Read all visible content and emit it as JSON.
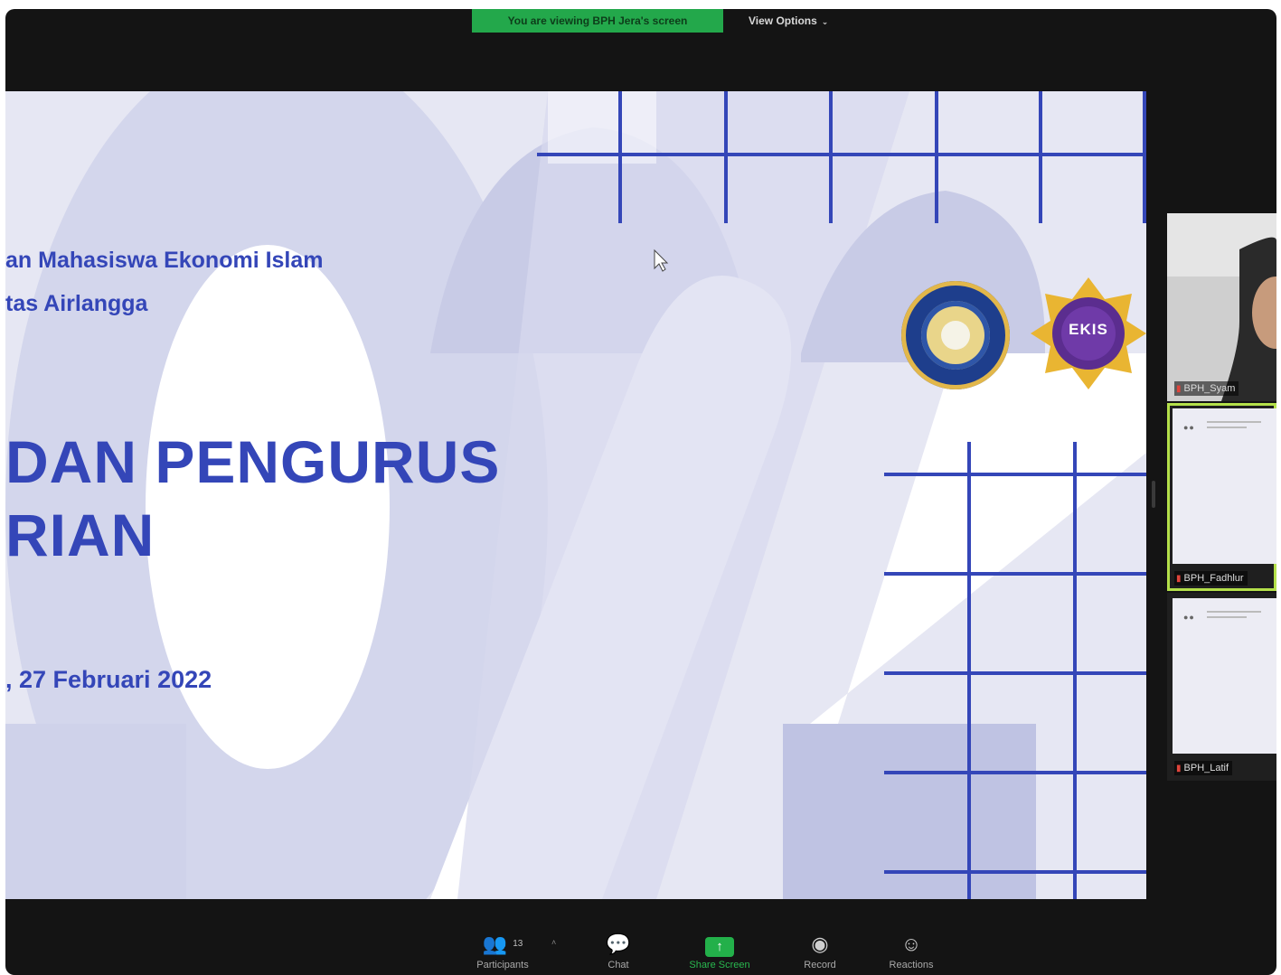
{
  "share_bar": {
    "viewing_text": "You are viewing BPH Jera's screen",
    "view_options": "View Options"
  },
  "slide": {
    "org_line1": "an Mahasiswa Ekonomi Islam",
    "org_line2": "tas Airlangga",
    "title_line1": "DAN PENGURUS",
    "title_line2": "RIAN",
    "date": ", 27 Februari 2022",
    "logo_left": "Universitas Airlangga seal",
    "logo_right_text": "EKIS",
    "accent_color": "#3446b8",
    "background_color": "#e6e7f3"
  },
  "gallery": {
    "tiles": [
      {
        "name": "BPH_Syam"
      },
      {
        "name": "BPH_Fadhlur"
      },
      {
        "name": "BPH_Latif"
      }
    ]
  },
  "toolbar": {
    "participants_label": "Participants",
    "participants_count": "13",
    "chat_label": "Chat",
    "share_label": "Share Screen",
    "record_label": "Record",
    "reactions_label": "Reactions"
  }
}
